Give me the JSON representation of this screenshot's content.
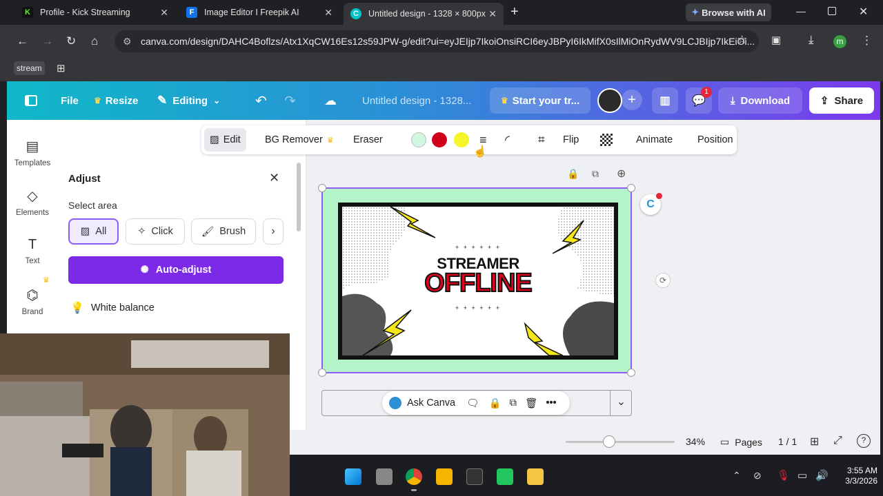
{
  "browser": {
    "tabs": [
      {
        "title": "Profile - Kick Streaming",
        "icon": "kick-icon",
        "color": "#53fc18"
      },
      {
        "title": "Image Editor I Freepik AI",
        "icon": "freepik-icon",
        "color": "#1273eb"
      },
      {
        "title": "Untitled design - 1328 × 800px",
        "icon": "canva-icon",
        "color": "#00c4cc"
      }
    ],
    "browse_ai": "Browse with AI",
    "url": "canva.com/design/DAHC4Boflzs/Atx1XqCW16Es12s59JPW-g/edit?ui=eyJEIjp7IkoiOnsiRCI6eyJBPyI6IkMifX0sIlMiOnRydWV9LCJBIjp7IkEiOi...",
    "bookmark_label": "stream",
    "profile_initial": "m"
  },
  "canva": {
    "file": "File",
    "resize": "Resize",
    "editing": "Editing",
    "doc_title": "Untitled design - 1328...",
    "trial": "Start your tr...",
    "notification_count": "1",
    "download": "Download",
    "share": "Share",
    "rail": [
      {
        "label": "Templates",
        "icon": "templates-icon"
      },
      {
        "label": "Elements",
        "icon": "elements-icon"
      },
      {
        "label": "Text",
        "icon": "text-icon"
      },
      {
        "label": "Brand",
        "icon": "brand-icon"
      }
    ],
    "panel": {
      "title": "Adjust",
      "select_area": "Select area",
      "areas": [
        "All",
        "Click",
        "Brush"
      ],
      "auto_adjust": "Auto-adjust",
      "white_balance": "White balance"
    },
    "toolbar": {
      "edit": "Edit",
      "bg_remover": "BG Remover",
      "eraser": "Eraser",
      "swatches": [
        "#d1f7e0",
        "#d0021b",
        "#f5f52a"
      ],
      "flip": "Flip",
      "animate": "Animate",
      "position": "Position"
    },
    "artwork": {
      "line1": "STREAMER",
      "line2": "OFFLINE",
      "dots": "+ + + + + +"
    },
    "ask_canva": "Ask Canva",
    "zoom_percent": 34,
    "zoom_label": "34%",
    "pages": "Pages",
    "page_count": "1 / 1"
  },
  "taskbar": {
    "time": "3:55 AM",
    "date": "3/3/2026"
  }
}
